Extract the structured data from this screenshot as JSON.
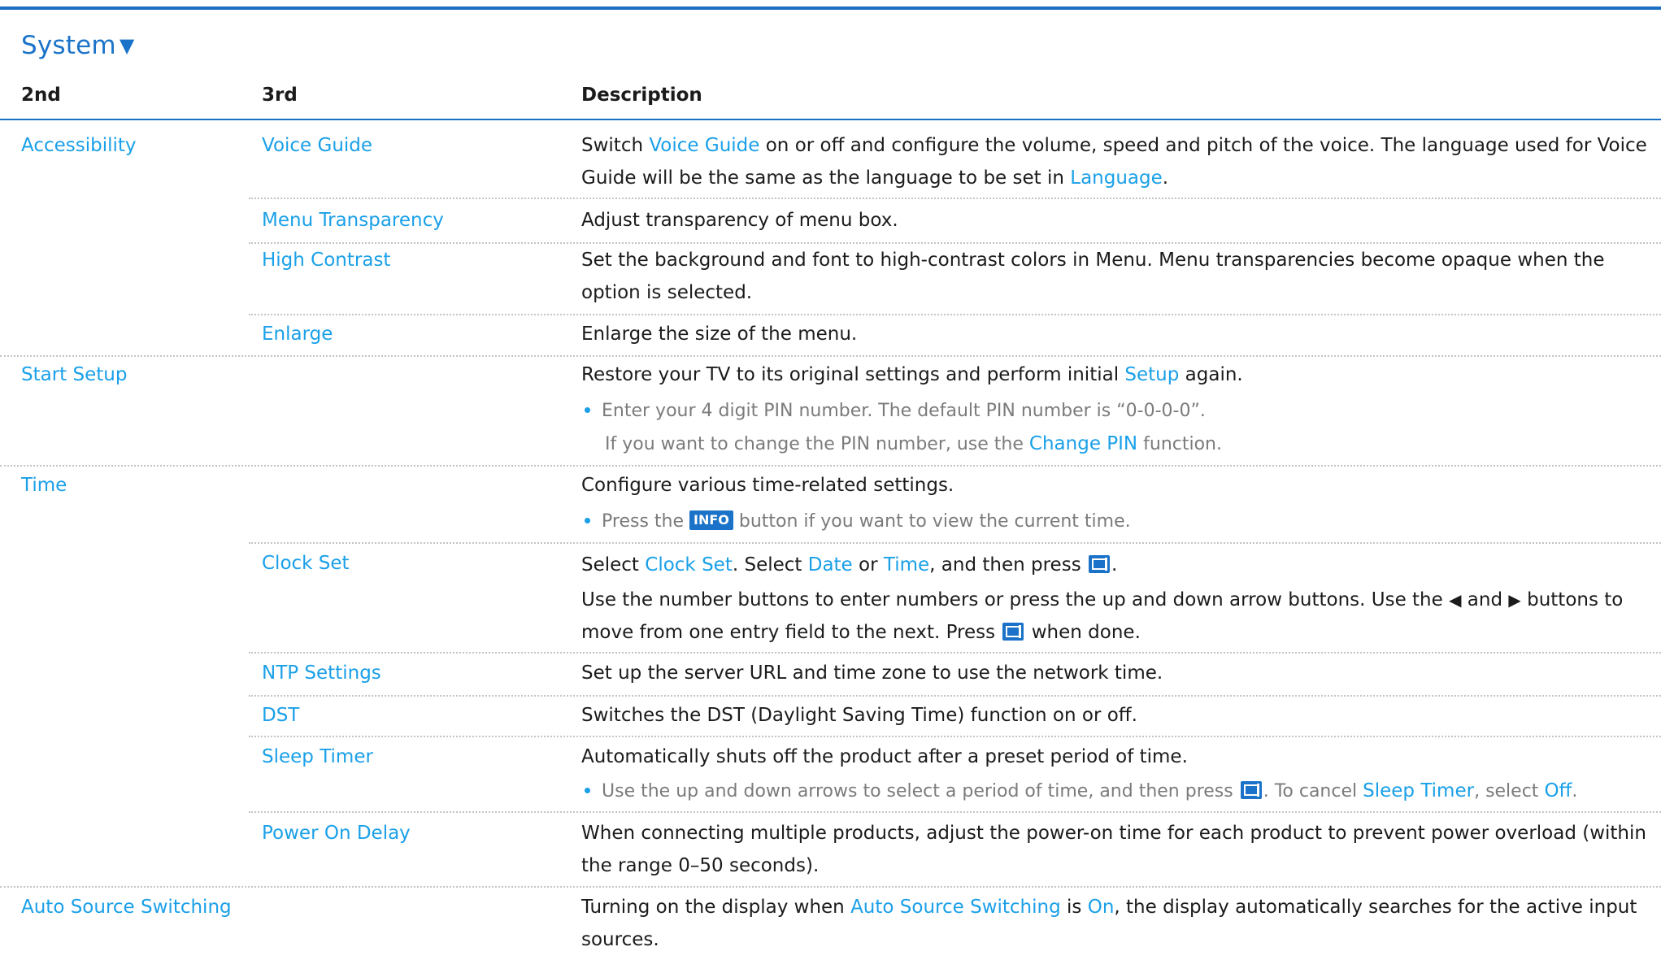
{
  "section": {
    "title": "System",
    "toggle_icon": "triangle-down-icon"
  },
  "columns": {
    "second": "2nd",
    "third": "3rd",
    "description": "Description"
  },
  "rows": {
    "accessibility": {
      "label": "Accessibility",
      "voice_guide": {
        "label": "Voice Guide",
        "d1": "Switch ",
        "d_link1": "Voice Guide",
        "d2": " on or off and configure the volume, speed and pitch of the voice. The language used for Voice Guide will be the same as the language to be set in ",
        "d_link2": "Language",
        "d3": "."
      },
      "menu_transparency": {
        "label": "Menu Transparency",
        "desc": "Adjust transparency of menu box."
      },
      "high_contrast": {
        "label": "High Contrast",
        "desc": "Set the background and font to high-contrast colors in Menu. Menu transparencies become opaque when the option is selected."
      },
      "enlarge": {
        "label": "Enlarge",
        "desc": "Enlarge the size of the menu."
      }
    },
    "start_setup": {
      "label": "Start Setup",
      "d1": "Restore your TV to its original settings and perform initial ",
      "d_link": "Setup",
      "d2": " again.",
      "note1": "Enter your 4 digit PIN number. The default PIN number is “0-0-0-0”.",
      "note2a": "If you want to change the PIN number, use the ",
      "note2_link": "Change PIN",
      "note2b": " function."
    },
    "time": {
      "label": "Time",
      "desc": "Configure various time-related settings.",
      "note_a": "Press the ",
      "note_button": "INFO",
      "note_b": " button if you want to view the current time.",
      "clock_set": {
        "label": "Clock Set",
        "d1": "Select ",
        "d_link1": "Clock Set",
        "d2": ". Select ",
        "d_link2": "Date",
        "d3": " or ",
        "d_link3": "Time",
        "d4": ", and then press ",
        "d5": ".",
        "p2a": "Use the number buttons to enter numbers or press the up and down arrow buttons. Use the ",
        "p2_left": "◀",
        "p2b": " and ",
        "p2_right": "▶",
        "p2c": " buttons to move from one entry field to the next. Press ",
        "p2d": " when done."
      },
      "ntp": {
        "label": "NTP Settings",
        "desc": "Set up the server URL and time zone to use the network time."
      },
      "dst": {
        "label": "DST",
        "desc": "Switches the DST (Daylight Saving Time) function on or off."
      },
      "sleep_timer": {
        "label": "Sleep Timer",
        "desc": "Automatically shuts off the product after a preset period of time.",
        "note_a": "Use the up and down arrows to select a period of time, and then press ",
        "note_b": ". To cancel ",
        "note_link1": "Sleep Timer",
        "note_c": ", select ",
        "note_link2": "Off",
        "note_d": "."
      },
      "power_on_delay": {
        "label": "Power On Delay",
        "desc": "When connecting multiple products, adjust the power-on time for each product to prevent power overload (within the range 0–50 seconds)."
      }
    },
    "auto_source": {
      "label": "Auto Source Switching",
      "d1": "Turning on the display when ",
      "d_link1": "Auto Source Switching",
      "d2": " is ",
      "d_link2": "On",
      "d3": ", the display automatically searches for the active input sources."
    }
  },
  "icons": {
    "enter": "enter-button-icon",
    "bullet": "bullet-icon"
  },
  "colors": {
    "accent": "#1a73c8",
    "link": "#1aa0e8",
    "note": "#7b7b7b"
  }
}
